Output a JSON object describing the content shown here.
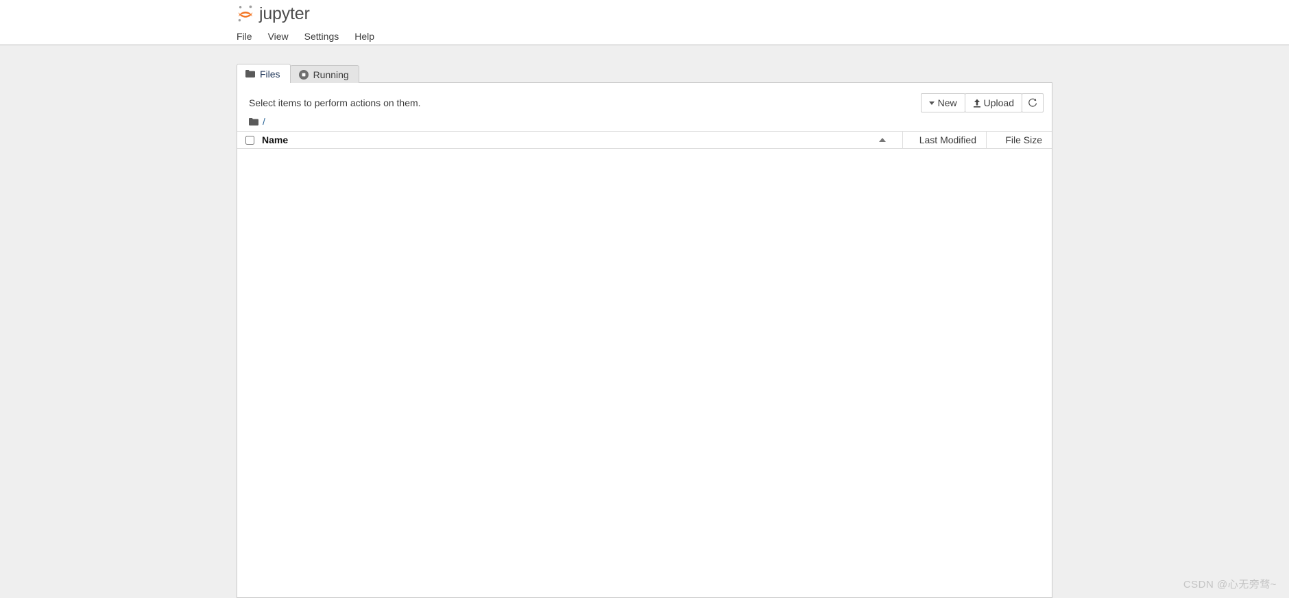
{
  "app": {
    "title": "jupyter",
    "logo_icon": "jupyter-logo-icon",
    "logo_color": "#f37726",
    "logo_dot_color": "#9e9e9e"
  },
  "menu": {
    "items": [
      {
        "label": "File"
      },
      {
        "label": "View"
      },
      {
        "label": "Settings"
      },
      {
        "label": "Help"
      }
    ]
  },
  "tabs": [
    {
      "label": "Files",
      "icon": "folder-icon",
      "active": true
    },
    {
      "label": "Running",
      "icon": "stop-circle-icon",
      "active": false
    }
  ],
  "panel": {
    "select_hint": "Select items to perform actions on them.",
    "toolbar": {
      "new_label": "New",
      "new_icon": "caret-down-icon",
      "upload_label": "Upload",
      "upload_icon": "upload-icon",
      "refresh_label": "",
      "refresh_icon": "refresh-icon"
    },
    "breadcrumb": {
      "folder_icon": "folder-icon",
      "root_label": "/"
    },
    "table": {
      "select_all_checked": false,
      "columns": [
        {
          "key": "name",
          "label": "Name",
          "sorted": true,
          "sort_dir": "asc"
        },
        {
          "key": "last_modified",
          "label": "Last Modified"
        },
        {
          "key": "file_size",
          "label": "File Size"
        }
      ],
      "rows": []
    }
  },
  "watermark": {
    "text": "CSDN @心无旁骛~",
    "color": "#c4c4c4"
  },
  "colors": {
    "page_background": "#efefef",
    "panel_background": "#ffffff",
    "border": "#c8c8c8",
    "accent": "#f37726",
    "link": "#2a6496",
    "active_tab_text": "#23395b"
  }
}
